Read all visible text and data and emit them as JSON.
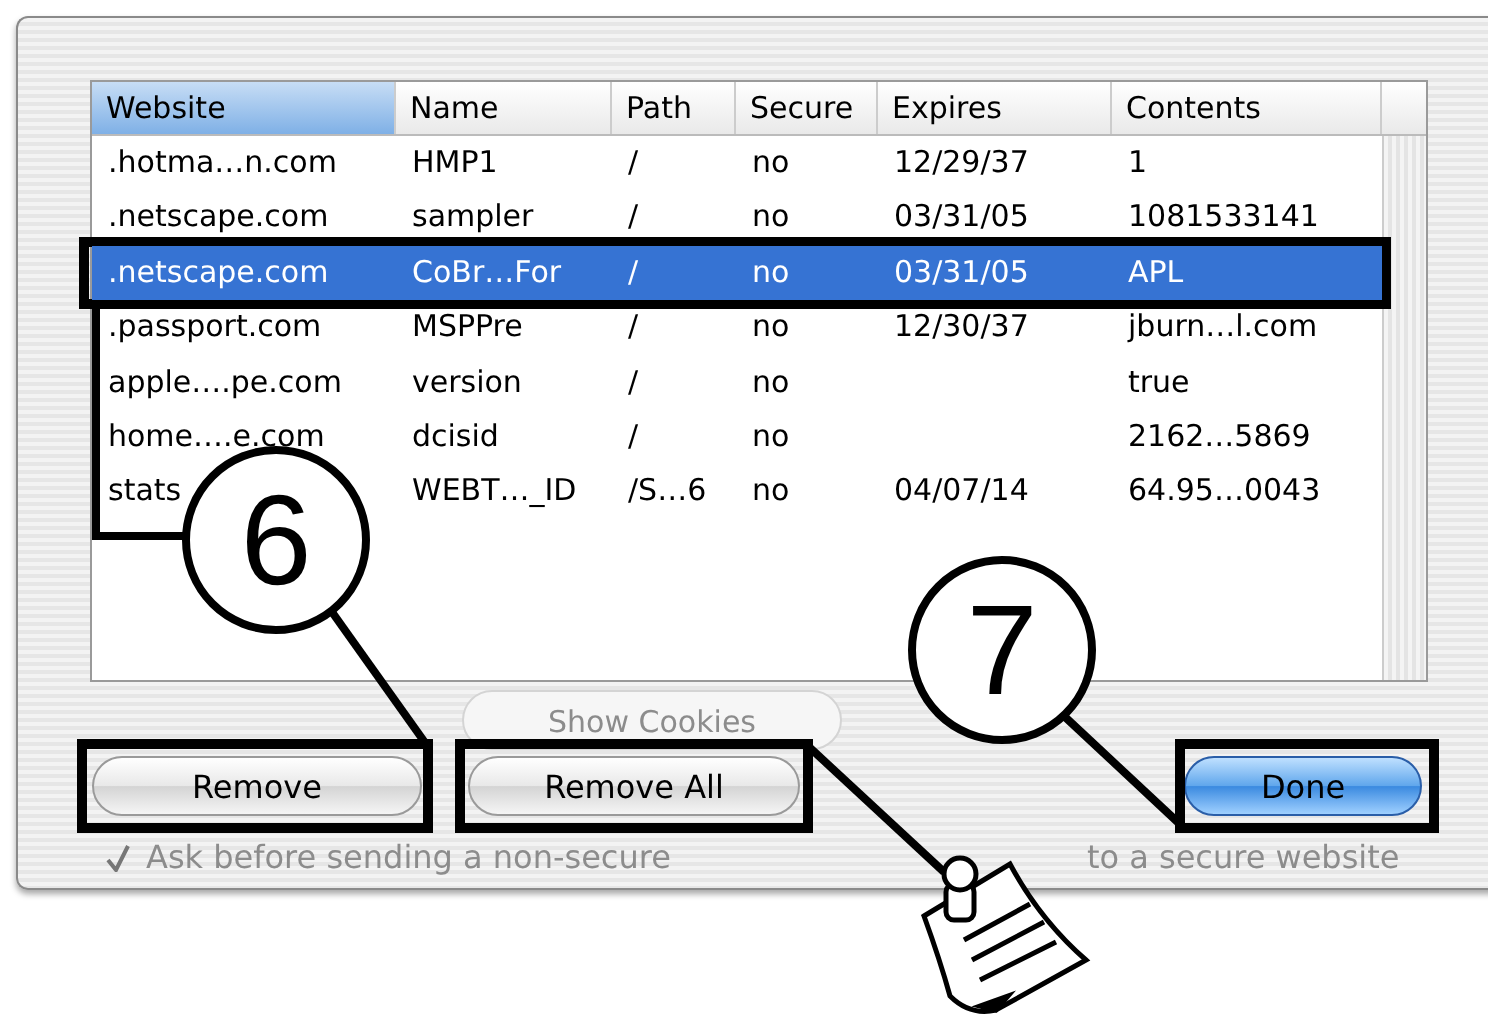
{
  "table": {
    "columns": [
      {
        "label": "Website",
        "sorted": true
      },
      {
        "label": "Name",
        "sorted": false
      },
      {
        "label": "Path",
        "sorted": false
      },
      {
        "label": "Secure",
        "sorted": false
      },
      {
        "label": "Expires",
        "sorted": false
      },
      {
        "label": "Contents",
        "sorted": false
      }
    ],
    "rows": [
      {
        "cells": [
          ".hotma…n.com",
          "HMP1",
          "/",
          "no",
          "12/29/37",
          "1"
        ],
        "selected": false
      },
      {
        "cells": [
          ".netscape.com",
          "sampler",
          "/",
          "no",
          "03/31/05",
          "1081533141"
        ],
        "selected": false
      },
      {
        "cells": [
          ".netscape.com",
          "CoBr…For",
          "/",
          "no",
          "03/31/05",
          "APL"
        ],
        "selected": true
      },
      {
        "cells": [
          ".passport.com",
          "MSPPre",
          "/",
          "no",
          "12/30/37",
          "jburn…l.com"
        ],
        "selected": false
      },
      {
        "cells": [
          "apple….pe.com",
          "version",
          "/",
          "no",
          "",
          "true"
        ],
        "selected": false
      },
      {
        "cells": [
          "home….e.com",
          "dcisid",
          "/",
          "no",
          "",
          "2162…5869"
        ],
        "selected": false
      },
      {
        "cells": [
          "stats",
          "WEBT…_ID",
          "/S…6",
          "no",
          "04/07/14",
          "64.95…0043"
        ],
        "selected": false
      }
    ]
  },
  "background_button": {
    "label": "Show Cookies",
    "disabled": true
  },
  "buttons": [
    {
      "label": "Remove",
      "kind": "plain"
    },
    {
      "label": "Remove All",
      "kind": "plain"
    },
    {
      "label": "Done",
      "kind": "default"
    }
  ],
  "background_checkbox": {
    "checked": true,
    "label_parts": [
      "Ask before sending a non-secure",
      "to a secure website"
    ]
  },
  "callouts": [
    {
      "number": "6"
    },
    {
      "number": "7"
    }
  ]
}
